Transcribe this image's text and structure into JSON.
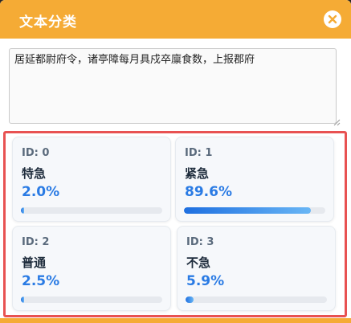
{
  "dialog": {
    "title": "文本分类",
    "close_icon": "close-circle-icon"
  },
  "input": {
    "value": "居延都尉府令，诸亭障每月具戍卒廪食数，上报郡府"
  },
  "results": [
    {
      "id_label": "ID: 0",
      "label": "特急",
      "percent_text": "2.0%",
      "value": 0.02
    },
    {
      "id_label": "ID: 1",
      "label": "紧急",
      "percent_text": "89.6%",
      "value": 0.896
    },
    {
      "id_label": "ID: 2",
      "label": "普通",
      "percent_text": "2.5%",
      "value": 0.025
    },
    {
      "id_label": "ID: 3",
      "label": "不急",
      "percent_text": "5.9%",
      "value": 0.059
    }
  ],
  "colors": {
    "header": "#f5ab35",
    "highlight_border": "#e85252",
    "percent": "#2a7be4"
  }
}
